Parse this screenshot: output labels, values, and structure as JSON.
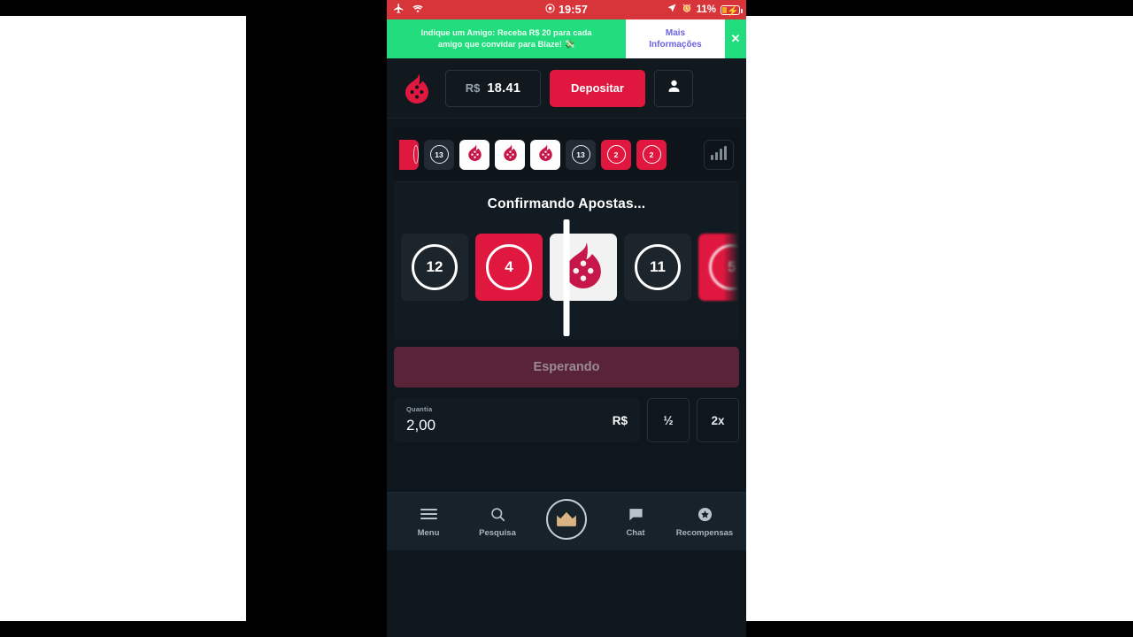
{
  "status_bar": {
    "airplane_icon": "airplane-icon",
    "wifi_icon": "wifi-icon",
    "record_icon": "record-dot-icon",
    "time": "19:57",
    "location_icon": "location-arrow-icon",
    "alarm_icon": "alarm-clock-icon",
    "battery_percent": "11%",
    "charging_icon": "lightning-bolt-icon",
    "bg_color": "#d8353a"
  },
  "promo_banner": {
    "line1": "Indique um Amigo: Receba R$ 20 para cada",
    "line2": "amigo que convidar para Blaze! 💸",
    "cta_line1": "Mais",
    "cta_line2": "Informações",
    "close_label": "✕",
    "bg_color": "#22dd7e",
    "cta_color": "#6c63e0"
  },
  "app_header": {
    "logo_name": "blaze-flame-logo",
    "currency": "R$",
    "balance": "18.41",
    "deposit_label": "Depositar",
    "deposit_color": "#e0173f",
    "account_icon": "user-avatar-icon"
  },
  "history": {
    "stats_icon": "bar-chart-icon",
    "tiles": [
      {
        "value": "",
        "color": "red",
        "cut": true
      },
      {
        "value": "13",
        "color": "black",
        "cut": false
      },
      {
        "value": "logo",
        "color": "white",
        "cut": false
      },
      {
        "value": "logo",
        "color": "white",
        "cut": false
      },
      {
        "value": "logo",
        "color": "white",
        "cut": false
      },
      {
        "value": "13",
        "color": "black",
        "cut": false
      },
      {
        "value": "2",
        "color": "red",
        "cut": false
      },
      {
        "value": "2",
        "color": "red",
        "cut": false
      }
    ]
  },
  "roulette": {
    "status_title": "Confirmando Apostas...",
    "pointer_name": "reel-pointer",
    "tiles": [
      {
        "value": "12",
        "color": "black",
        "blurred": false
      },
      {
        "value": "4",
        "color": "red",
        "blurred": false
      },
      {
        "value": "logo",
        "color": "white",
        "blurred": false
      },
      {
        "value": "11",
        "color": "black",
        "blurred": false
      },
      {
        "value": "5",
        "color": "red",
        "blurred": true
      }
    ]
  },
  "bet_panel": {
    "wait_label": "Esperando",
    "wait_color": "#5a2438",
    "amount_label": "Quantia",
    "amount_value": "2,00",
    "amount_suffix": "R$",
    "half_label": "½",
    "double_label": "2x"
  },
  "bottom_nav": {
    "items": [
      {
        "label": "Menu",
        "icon": "hamburger-menu-icon"
      },
      {
        "label": "Pesquisa",
        "icon": "search-icon"
      },
      {
        "label": "",
        "icon": "crown-icon"
      },
      {
        "label": "Chat",
        "icon": "chat-bubble-icon"
      },
      {
        "label": "Recompensas",
        "icon": "star-badge-icon"
      }
    ]
  }
}
